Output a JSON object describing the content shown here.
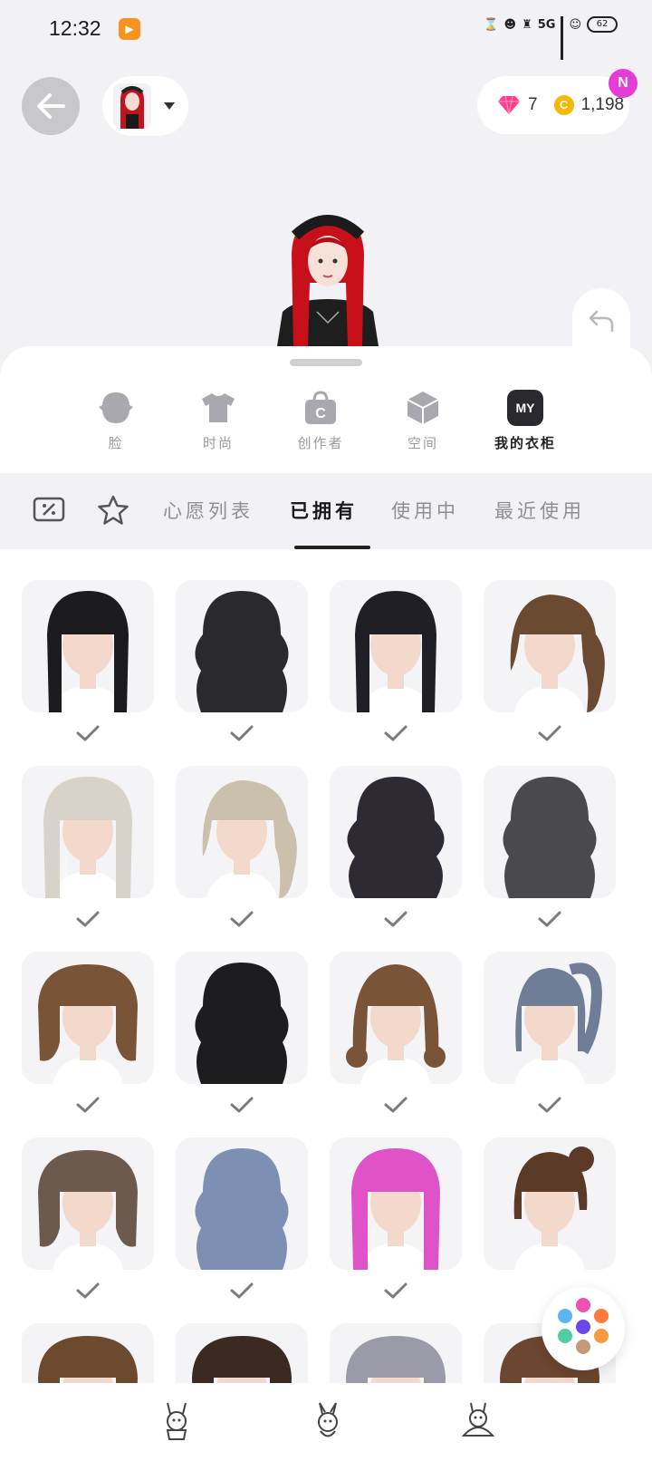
{
  "status_bar": {
    "time": "12:32",
    "network": "5G",
    "battery": "62"
  },
  "header": {
    "gems": "7",
    "coins": "1,198",
    "coin_symbol": "C",
    "new_badge": "N"
  },
  "categories": [
    {
      "label": "脸",
      "icon": "face-icon"
    },
    {
      "label": "时尚",
      "icon": "shirt-icon"
    },
    {
      "label": "创作者",
      "icon": "creator-bag-icon"
    },
    {
      "label": "空间",
      "icon": "cube-icon"
    },
    {
      "label": "我的衣柜",
      "icon": "my-icon",
      "icon_text": "MY",
      "active": true
    }
  ],
  "filter_tabs": [
    {
      "label": "心愿列表"
    },
    {
      "label": "已拥有",
      "active": true
    },
    {
      "label": "使用中"
    },
    {
      "label": "最近使用"
    }
  ],
  "colors": {
    "accent_badge": "#e53cd5",
    "coin": "#f5b800",
    "gem": "#ff3d8a",
    "sheet_bg": "#ffffff",
    "page_bg": "#f2f2f6"
  },
  "hair_items": [
    {
      "name": "long-black-straight-bangs",
      "color": "#1c1c1e",
      "style": "straight-long",
      "owned": true
    },
    {
      "name": "black-half-up",
      "color": "#2a2a2c",
      "style": "wavy-long",
      "owned": true
    },
    {
      "name": "black-hime-bangs",
      "color": "#1f1f25",
      "style": "straight-long",
      "owned": true
    },
    {
      "name": "brown-side-ponytail",
      "color": "#6b4a32",
      "style": "side-pony",
      "owned": true
    },
    {
      "name": "silver-braided",
      "color": "#d8d2c8",
      "style": "braided",
      "owned": true
    },
    {
      "name": "ash-ponytail",
      "color": "#cbbfae",
      "style": "side-pony",
      "owned": true
    },
    {
      "name": "black-curly-long",
      "color": "#2d2a33",
      "style": "curly-long",
      "owned": true
    },
    {
      "name": "gray-wavy-long",
      "color": "#4a4a4e",
      "style": "wavy-long",
      "owned": true
    },
    {
      "name": "brown-bob-bangs",
      "color": "#7a5436",
      "style": "bob",
      "owned": true
    },
    {
      "name": "black-long-waves",
      "color": "#1d1d20",
      "style": "wavy-long",
      "owned": true
    },
    {
      "name": "brown-low-buns",
      "color": "#7a5438",
      "style": "buns",
      "owned": true
    },
    {
      "name": "blue-gray-ponytail",
      "color": "#6f7d96",
      "style": "high-pony",
      "owned": true
    },
    {
      "name": "taupe-short-bob",
      "color": "#6d5a4e",
      "style": "bob",
      "owned": true
    },
    {
      "name": "blue-long-waves",
      "color": "#7d8fb2",
      "style": "wavy-long",
      "owned": true
    },
    {
      "name": "pink-braids",
      "color": "#e052c8",
      "style": "braided",
      "owned": true
    },
    {
      "name": "brown-updo-clip",
      "color": "#5a3a26",
      "style": "updo",
      "owned": true
    }
  ],
  "partial_row": [
    {
      "name": "brown-yellow-clips",
      "color": "#6b4a30"
    },
    {
      "name": "dark-bun",
      "color": "#3a2a22"
    },
    {
      "name": "silver-top",
      "color": "#9a9aa8"
    },
    {
      "name": "brown-top",
      "color": "#6b4630"
    }
  ],
  "palette_fab_colors": [
    "#f050b0",
    "#ff7a3d",
    "#5bb5f0",
    "#6a46e8",
    "#f59a3d",
    "#4ecfa0",
    "#c09a7a"
  ]
}
